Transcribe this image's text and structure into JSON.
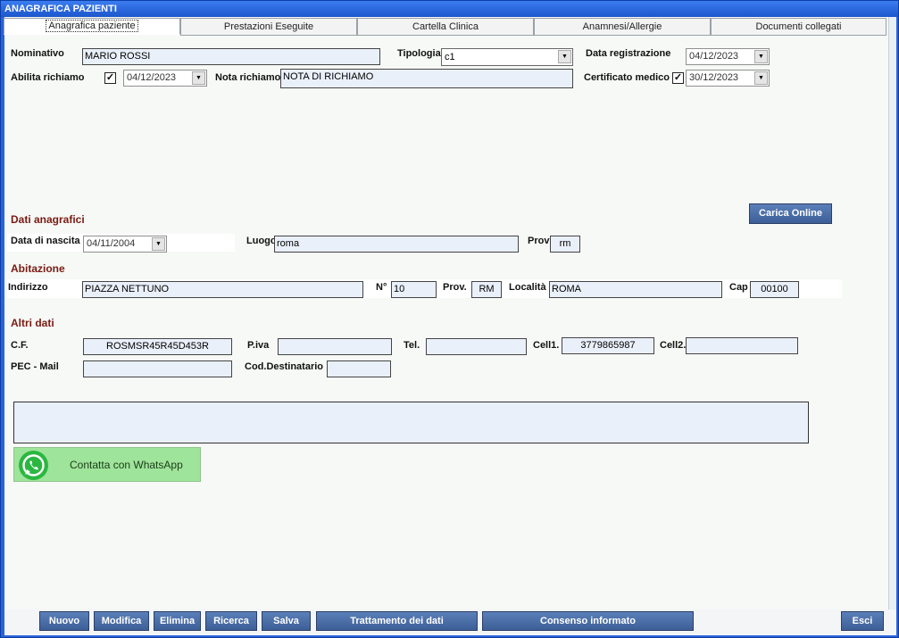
{
  "window": {
    "title": "ANAGRAFICA PAZIENTI"
  },
  "tabs": [
    {
      "label": "Anagrafica paziente"
    },
    {
      "label": "Prestazioni Eseguite"
    },
    {
      "label": "Cartella Clinica"
    },
    {
      "label": "Anamnesi/Allergie"
    },
    {
      "label": "Documenti collegati"
    }
  ],
  "header": {
    "nominativo_label": "Nominativo",
    "nominativo_value": "MARIO ROSSI",
    "tipologia_label": "Tipologia",
    "tipologia_value": "c1",
    "data_registrazione_label": "Data registrazione",
    "data_registrazione_value": "04/12/2023",
    "abilita_richiamo_label": "Abilita richiamo",
    "abilita_richiamo_date": "04/12/2023",
    "nota_richiamo_label": "Nota richiamo",
    "nota_richiamo_value": "NOTA DI RICHIAMO",
    "certificato_medico_label": "Certificato medico",
    "certificato_medico_date": "30/12/2023",
    "check_mark": "✓",
    "dd_arrow": "▼"
  },
  "carica_online_label": "Carica Online",
  "dati_anagrafici": {
    "title": "Dati anagrafici",
    "nascita_label": "Data di nascita",
    "nascita_value": "04/11/2004",
    "luogo_label": "Luogo",
    "luogo_value": "roma",
    "prov_label": "Prov",
    "prov_value": "rm"
  },
  "abitazione": {
    "title": "Abitazione",
    "indirizzo_label": "Indirizzo",
    "indirizzo_value": "PIAZZA NETTUNO",
    "numero_label": "N°",
    "numero_value": "10",
    "prov_label": "Prov.",
    "prov_value": "RM",
    "localita_label": "Località",
    "localita_value": "ROMA",
    "cap_label": "Cap",
    "cap_value": "00100"
  },
  "altri_dati": {
    "title": "Altri dati",
    "cf_label": "C.F.",
    "cf_value": "ROSMSR45R45D453R",
    "piva_label": "P.iva",
    "piva_value": "",
    "tel_label": "Tel.",
    "tel_value": "",
    "cell1_label": "Cell1.",
    "cell1_value": "3779865987",
    "cell2_label": "Cell2.",
    "cell2_value": "",
    "pec_label": "PEC - Mail",
    "pec_value": "",
    "coddest_label": "Cod.Destinatario",
    "coddest_value": ""
  },
  "whatsapp": {
    "label": "Contatta con WhatsApp",
    "icon": "whatsapp-icon",
    "color": "#2bb741"
  },
  "toolbar": {
    "nuovo": "Nuovo",
    "modifica": "Modifica",
    "elimina": "Elimina",
    "ricerca": "Ricerca",
    "salva": "Salva",
    "trattamento": "Trattamento dei dati",
    "consenso": "Consenso informato",
    "esci": "Esci"
  },
  "colors": {
    "accent": "#2a62d8",
    "section": "#7a1a12",
    "field_bg": "#eaf0fa",
    "button": "#4a6ca6"
  }
}
